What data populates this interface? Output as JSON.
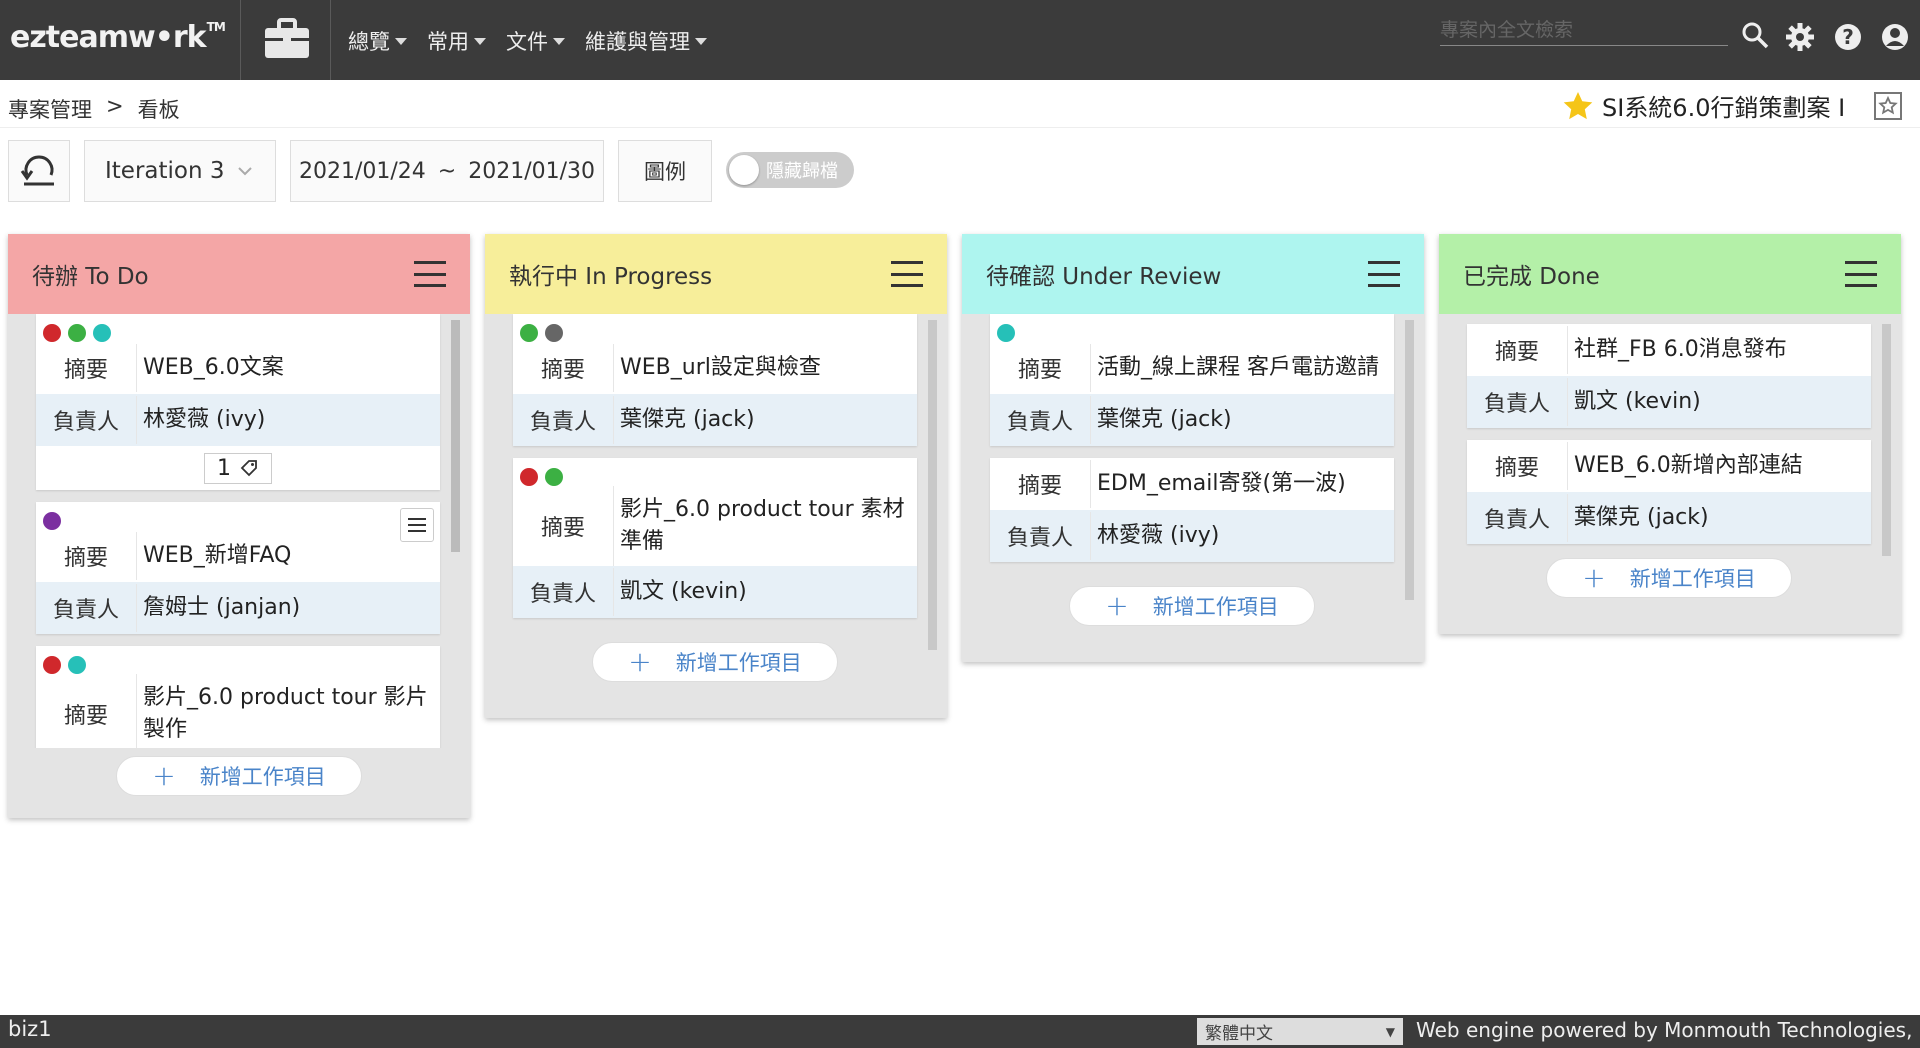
{
  "app": {
    "logo": "ezteamw•rk",
    "logo_tm": "TM",
    "search_placeholder": "專案內全文檢索"
  },
  "menus": [
    "總覽",
    "常用",
    "文件",
    "維護與管理"
  ],
  "breadcrumb": {
    "root": "專案管理",
    "sep": ">",
    "current": "看板"
  },
  "project": {
    "title": "SI系統6.0行銷策劃案 I"
  },
  "toolbar": {
    "iteration": "Iteration 3",
    "date_start": "2021/01/24",
    "date_sep": "~",
    "date_end": "2021/01/30",
    "legend": "圖例",
    "hide_label": "隱藏歸檔"
  },
  "labels": {
    "summary": "摘要",
    "owner": "負責人",
    "add": "新增工作項目"
  },
  "colors": {
    "red": "#d0282c",
    "green": "#3cb043",
    "teal": "#26c0b8",
    "gray": "#666666",
    "purple": "#7b2fa0",
    "todo": "#f4a6a6",
    "progress": "#f7ee9a",
    "review": "#aef5ef",
    "done": "#b4f0a8"
  },
  "columns": {
    "todo": {
      "title": "待辦 To Do",
      "cards": [
        {
          "summary": "WEB_6.0文案",
          "owner": "林愛薇 (ivy)",
          "tag_count": "1"
        },
        {
          "summary": "WEB_新增FAQ",
          "owner": "詹姆士 (janjan)"
        },
        {
          "summary": "影片_6.0 product tour 影片製作"
        }
      ]
    },
    "progress": {
      "title": "執行中 In Progress",
      "cards": [
        {
          "summary": "WEB_url設定與檢查",
          "owner": "葉傑克 (jack)"
        },
        {
          "summary": "影片_6.0 product tour 素材準備",
          "owner": "凱文 (kevin)"
        }
      ]
    },
    "review": {
      "title": "待確認 Under Review",
      "cards": [
        {
          "summary": "活動_線上課程 客戶電訪邀請",
          "owner": "葉傑克 (jack)"
        },
        {
          "summary": "EDM_email寄發(第一波)",
          "owner": "林愛薇 (ivy)"
        }
      ]
    },
    "done": {
      "title": "已完成 Done",
      "cards": [
        {
          "summary": "社群_FB 6.0消息發布",
          "owner": "凱文 (kevin)"
        },
        {
          "summary": "WEB_6.0新增內部連結",
          "owner": "葉傑克 (jack)"
        }
      ]
    }
  },
  "footer": {
    "server": "biz1",
    "language": "繁體中文",
    "powered": "Web engine powered by Monmouth Technologies, Inc."
  }
}
